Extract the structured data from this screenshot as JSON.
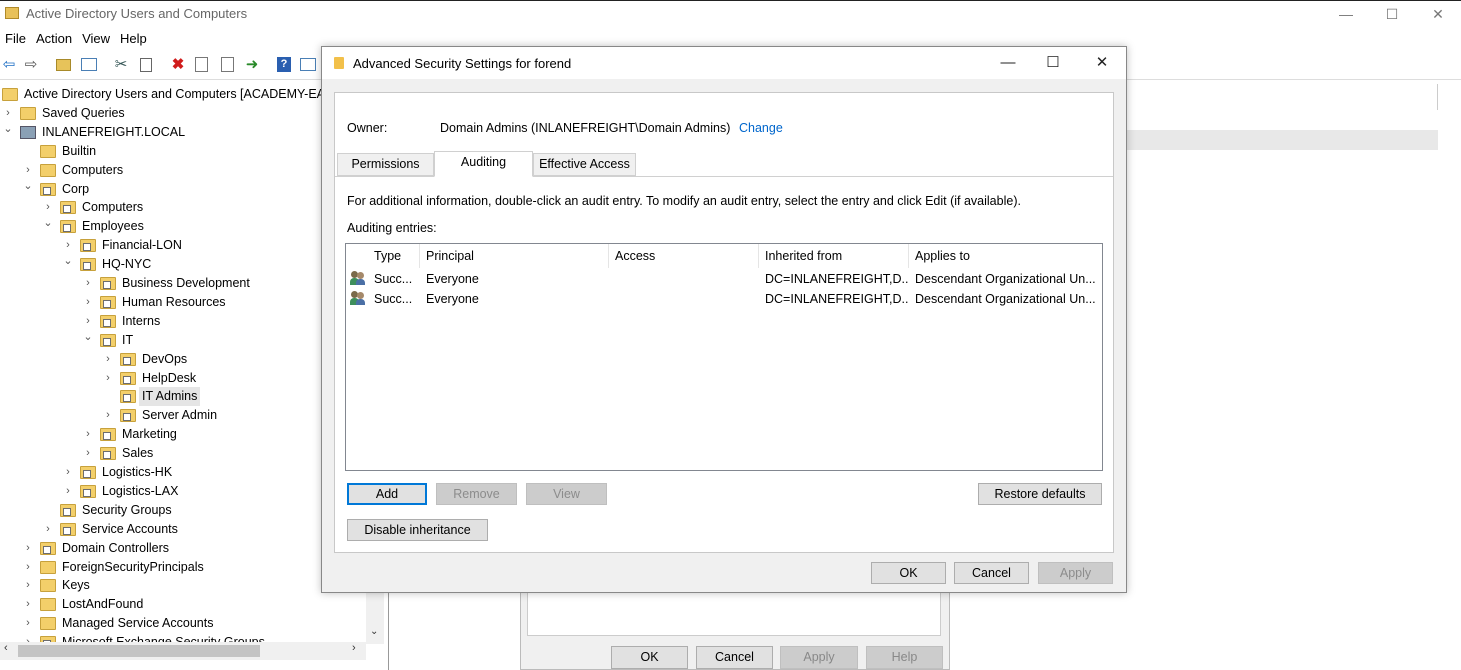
{
  "main_window": {
    "title": "Active Directory Users and Computers",
    "menu": [
      "File",
      "Action",
      "View",
      "Help"
    ],
    "buttons": {
      "minimize": "—",
      "maximize": "☐",
      "close": "✕"
    }
  },
  "tree": {
    "items": [
      {
        "label": "Active Directory Users and Computers [ACADEMY-EA-",
        "level": 0,
        "expander": "",
        "icon": "aduc-icon"
      },
      {
        "label": "Saved Queries",
        "level": 1,
        "expander": ">",
        "icon": "folder-icon"
      },
      {
        "label": "INLANEFREIGHT.LOCAL",
        "level": 1,
        "expander": "v",
        "icon": "domain-icon"
      },
      {
        "label": "Builtin",
        "level": 2,
        "expander": "",
        "icon": "folder-icon"
      },
      {
        "label": "Computers",
        "level": 2,
        "expander": ">",
        "icon": "folder-icon"
      },
      {
        "label": "Corp",
        "level": 2,
        "expander": "v",
        "icon": "ou-icon"
      },
      {
        "label": "Computers",
        "level": 3,
        "expander": ">",
        "icon": "ou-icon"
      },
      {
        "label": "Employees",
        "level": 3,
        "expander": "v",
        "icon": "ou-icon"
      },
      {
        "label": "Financial-LON",
        "level": 4,
        "expander": ">",
        "icon": "ou-icon"
      },
      {
        "label": "HQ-NYC",
        "level": 4,
        "expander": "v",
        "icon": "ou-icon"
      },
      {
        "label": "Business Development",
        "level": 5,
        "expander": ">",
        "icon": "ou-icon"
      },
      {
        "label": "Human Resources",
        "level": 5,
        "expander": ">",
        "icon": "ou-icon"
      },
      {
        "label": "Interns",
        "level": 5,
        "expander": ">",
        "icon": "ou-icon"
      },
      {
        "label": "IT",
        "level": 5,
        "expander": "v",
        "icon": "ou-icon"
      },
      {
        "label": "DevOps",
        "level": 6,
        "expander": ">",
        "icon": "ou-icon"
      },
      {
        "label": "HelpDesk",
        "level": 6,
        "expander": ">",
        "icon": "ou-icon"
      },
      {
        "label": "IT Admins",
        "level": 6,
        "expander": "",
        "icon": "ou-icon",
        "selected": true
      },
      {
        "label": "Server Admin",
        "level": 6,
        "expander": ">",
        "icon": "ou-icon"
      },
      {
        "label": "Marketing",
        "level": 5,
        "expander": ">",
        "icon": "ou-icon"
      },
      {
        "label": "Sales",
        "level": 5,
        "expander": ">",
        "icon": "ou-icon"
      },
      {
        "label": "Logistics-HK",
        "level": 4,
        "expander": ">",
        "icon": "ou-icon"
      },
      {
        "label": "Logistics-LAX",
        "level": 4,
        "expander": ">",
        "icon": "ou-icon"
      },
      {
        "label": "Security Groups",
        "level": 3,
        "expander": "",
        "icon": "ou-icon"
      },
      {
        "label": "Service Accounts",
        "level": 3,
        "expander": ">",
        "icon": "ou-icon"
      },
      {
        "label": "Domain Controllers",
        "level": 2,
        "expander": ">",
        "icon": "ou-icon"
      },
      {
        "label": "ForeignSecurityPrincipals",
        "level": 2,
        "expander": ">",
        "icon": "folder-icon"
      },
      {
        "label": "Keys",
        "level": 2,
        "expander": ">",
        "icon": "folder-icon"
      },
      {
        "label": "LostAndFound",
        "level": 2,
        "expander": ">",
        "icon": "folder-icon"
      },
      {
        "label": "Managed Service Accounts",
        "level": 2,
        "expander": ">",
        "icon": "folder-icon"
      },
      {
        "label": "Microsoft Exchange Security Groups",
        "level": 2,
        "expander": ">",
        "icon": "ou-icon"
      }
    ]
  },
  "back_dialog": {
    "buttons": {
      "ok": "OK",
      "cancel": "Cancel",
      "apply": "Apply",
      "help": "Help"
    }
  },
  "dialog": {
    "title": "Advanced Security Settings for forend",
    "owner_label": "Owner:",
    "owner_value": "Domain Admins (INLANEFREIGHT\\Domain Admins)",
    "owner_change": "Change",
    "tabs": [
      "Permissions",
      "Auditing",
      "Effective Access"
    ],
    "active_tab": "Auditing",
    "info": "For additional information, double-click an audit entry. To modify an audit entry, select the entry and click Edit (if available).",
    "entries_label": "Auditing entries:",
    "columns": {
      "type": "Type",
      "principal": "Principal",
      "access": "Access",
      "inherited": "Inherited from",
      "applies": "Applies to"
    },
    "rows": [
      {
        "type": "Succ...",
        "principal": "Everyone",
        "access": "",
        "inherited": "DC=INLANEFREIGHT,D...",
        "applies": "Descendant Organizational Un..."
      },
      {
        "type": "Succ...",
        "principal": "Everyone",
        "access": "",
        "inherited": "DC=INLANEFREIGHT,D...",
        "applies": "Descendant Organizational Un..."
      }
    ],
    "buttons": {
      "add": "Add",
      "remove": "Remove",
      "view": "View",
      "restore": "Restore defaults",
      "disable_inheritance": "Disable inheritance",
      "ok": "OK",
      "cancel": "Cancel",
      "apply": "Apply"
    }
  }
}
